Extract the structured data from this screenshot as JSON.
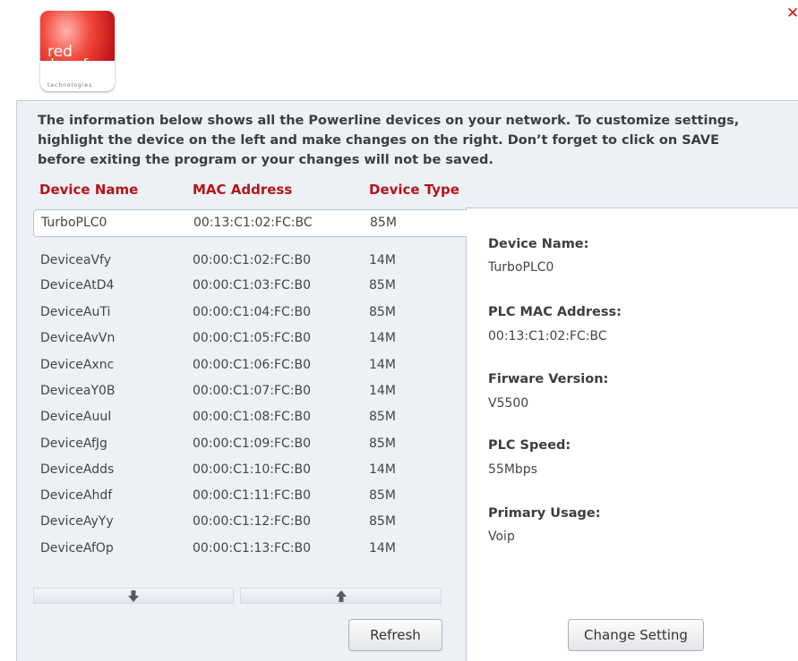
{
  "app": {
    "logo_line1": "red",
    "logo_line2": "dwarf",
    "logo_line3": "technologies",
    "close_glyph": "✕"
  },
  "intro": {
    "line1": "The information below shows all the Powerline devices on your network. To customize settings,",
    "line2": "highlight the device on the left and make changes on the right. Don’t forget to click on SAVE",
    "line3": "before exiting the program or your changes will not be saved."
  },
  "table": {
    "columns": [
      "Device Name",
      "MAC Address",
      "Device Type"
    ],
    "selected_index": 0,
    "rows": [
      {
        "name": "TurboPLC0",
        "mac": "00:13:C1:02:FC:BC",
        "type": "85M"
      },
      {
        "name": "DeviceaVfy",
        "mac": "00:00:C1:02:FC:B0",
        "type": "14M"
      },
      {
        "name": "DeviceAtD4",
        "mac": "00:00:C1:03:FC:B0",
        "type": "85M"
      },
      {
        "name": "DeviceAuTi",
        "mac": "00:00:C1:04:FC:B0",
        "type": "85M"
      },
      {
        "name": "DeviceAvVn",
        "mac": "00:00:C1:05:FC:B0",
        "type": "14M"
      },
      {
        "name": "DeviceAxnc",
        "mac": "00:00:C1:06:FC:B0",
        "type": "14M"
      },
      {
        "name": "DeviceaY0B",
        "mac": "00:00:C1:07:FC:B0",
        "type": "14M"
      },
      {
        "name": "DeviceAuuI",
        "mac": "00:00:C1:08:FC:B0",
        "type": "85M"
      },
      {
        "name": "DeviceAfJg",
        "mac": "00:00:C1:09:FC:B0",
        "type": "85M"
      },
      {
        "name": "DeviceAdds",
        "mac": "00:00:C1:10:FC:B0",
        "type": "14M"
      },
      {
        "name": "DeviceAhdf",
        "mac": "00:00:C1:11:FC:B0",
        "type": "85M"
      },
      {
        "name": "DeviceAyYy",
        "mac": "00:00:C1:12:FC:B0",
        "type": "85M"
      },
      {
        "name": "DeviceAfOp",
        "mac": "00:00:C1:13:FC:B0",
        "type": "14M"
      }
    ]
  },
  "details": {
    "device_name_label": "Device Name:",
    "device_name_value": "TurboPLC0",
    "mac_label": "PLC MAC Address:",
    "mac_value": "00:13:C1:02:FC:BC",
    "firmware_label": "Firware Version:",
    "firmware_value": "V5500",
    "speed_label": "PLC Speed:",
    "speed_value": "55Mbps",
    "usage_label": "Primary Usage:",
    "usage_value": "Voip"
  },
  "buttons": {
    "refresh": "Refresh",
    "change_setting": "Change Setting"
  },
  "icons": {
    "scroll_down": "arrow-down-icon",
    "scroll_up": "arrow-up-icon",
    "close": "close-icon"
  },
  "colors": {
    "accent": "#b4141a",
    "panel_bg": "#edf1f5",
    "logo_red": "#c8141a"
  }
}
